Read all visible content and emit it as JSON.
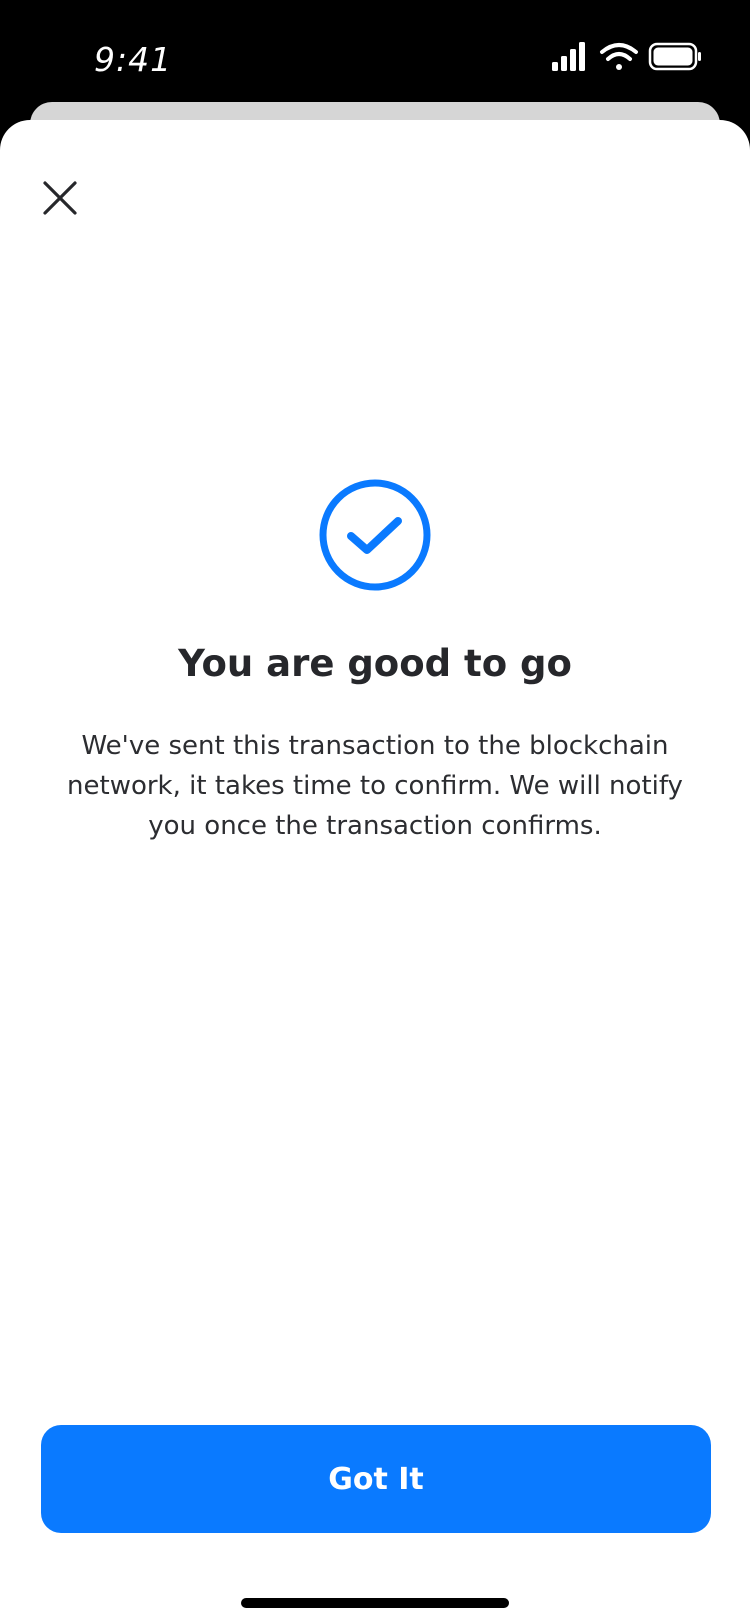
{
  "status_bar": {
    "time": "9:41",
    "icons": [
      "cellular-signal-icon",
      "wifi-icon",
      "battery-icon"
    ]
  },
  "sheet": {
    "close_icon": "close-icon",
    "success_icon": "check-circle-icon",
    "title": "You are good to go",
    "message": "We've sent this transaction to the blockchain network, it takes time to confirm. We will notify you once the transaction confirms.",
    "primary_button_label": "Got It"
  },
  "colors": {
    "accent": "#0a7aff",
    "title_text": "#26272b",
    "body_text": "#2c2d31",
    "status_bar_bg": "#000000",
    "sheet_bg": "#ffffff"
  }
}
